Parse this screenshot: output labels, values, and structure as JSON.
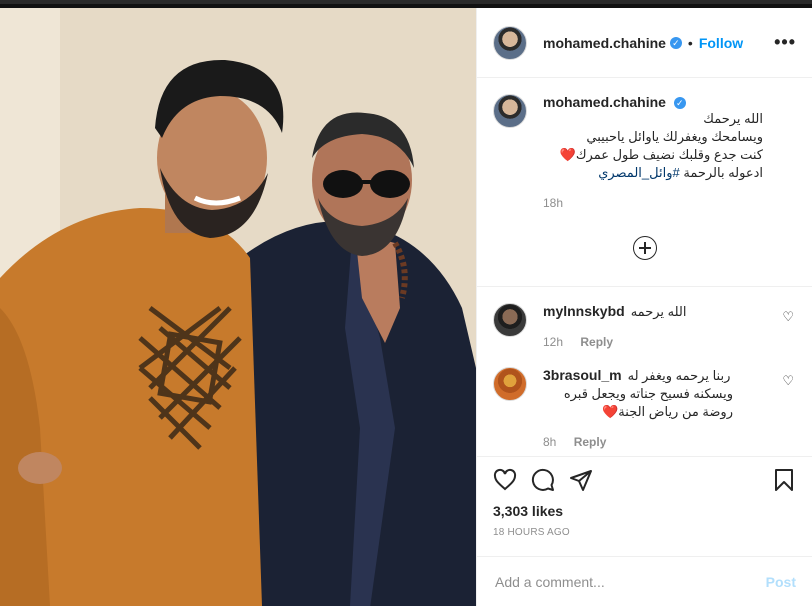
{
  "post": {
    "username": "mohamed.chahine",
    "verified_badge": "✓",
    "separator": "•",
    "follow_label": "Follow",
    "more_label": "•••"
  },
  "caption": {
    "username": "mohamed.chahine",
    "lines": [
      "الله يرحمك",
      "ويسامحك ويغفرلك ياوائل ياحبيبي",
      "كنت جدع وقلبك نضيف طول عمرك",
      "ادعوله بالرحمة"
    ],
    "heart": "❤️",
    "hashtag": "#وائل_المصري",
    "time": "18h"
  },
  "comments": [
    {
      "username": "mylnnskybd",
      "text": "الله يرحمه",
      "time": "12h",
      "reply_label": "Reply"
    },
    {
      "username": "3brasoul_m",
      "lines": [
        "ربنا يرحمه ويغفر له",
        "ويسكنه فسيح جناته ويجعل قبره",
        "روضة من رياض الجنة"
      ],
      "heart": "❤️",
      "time": "8h",
      "reply_label": "Reply"
    }
  ],
  "likes": "3,303 likes",
  "timestamp": "18 HOURS AGO",
  "add_comment_placeholder": "Add a comment...",
  "post_button": "Post",
  "colors": {
    "accent": "#0095f6",
    "verified": "#3897f0",
    "heart_red": "#ed4956",
    "muted": "#8e8e8e"
  },
  "icons": [
    "heart-icon",
    "comment-icon",
    "share-icon",
    "bookmark-icon",
    "add-icon",
    "more-icon"
  ]
}
